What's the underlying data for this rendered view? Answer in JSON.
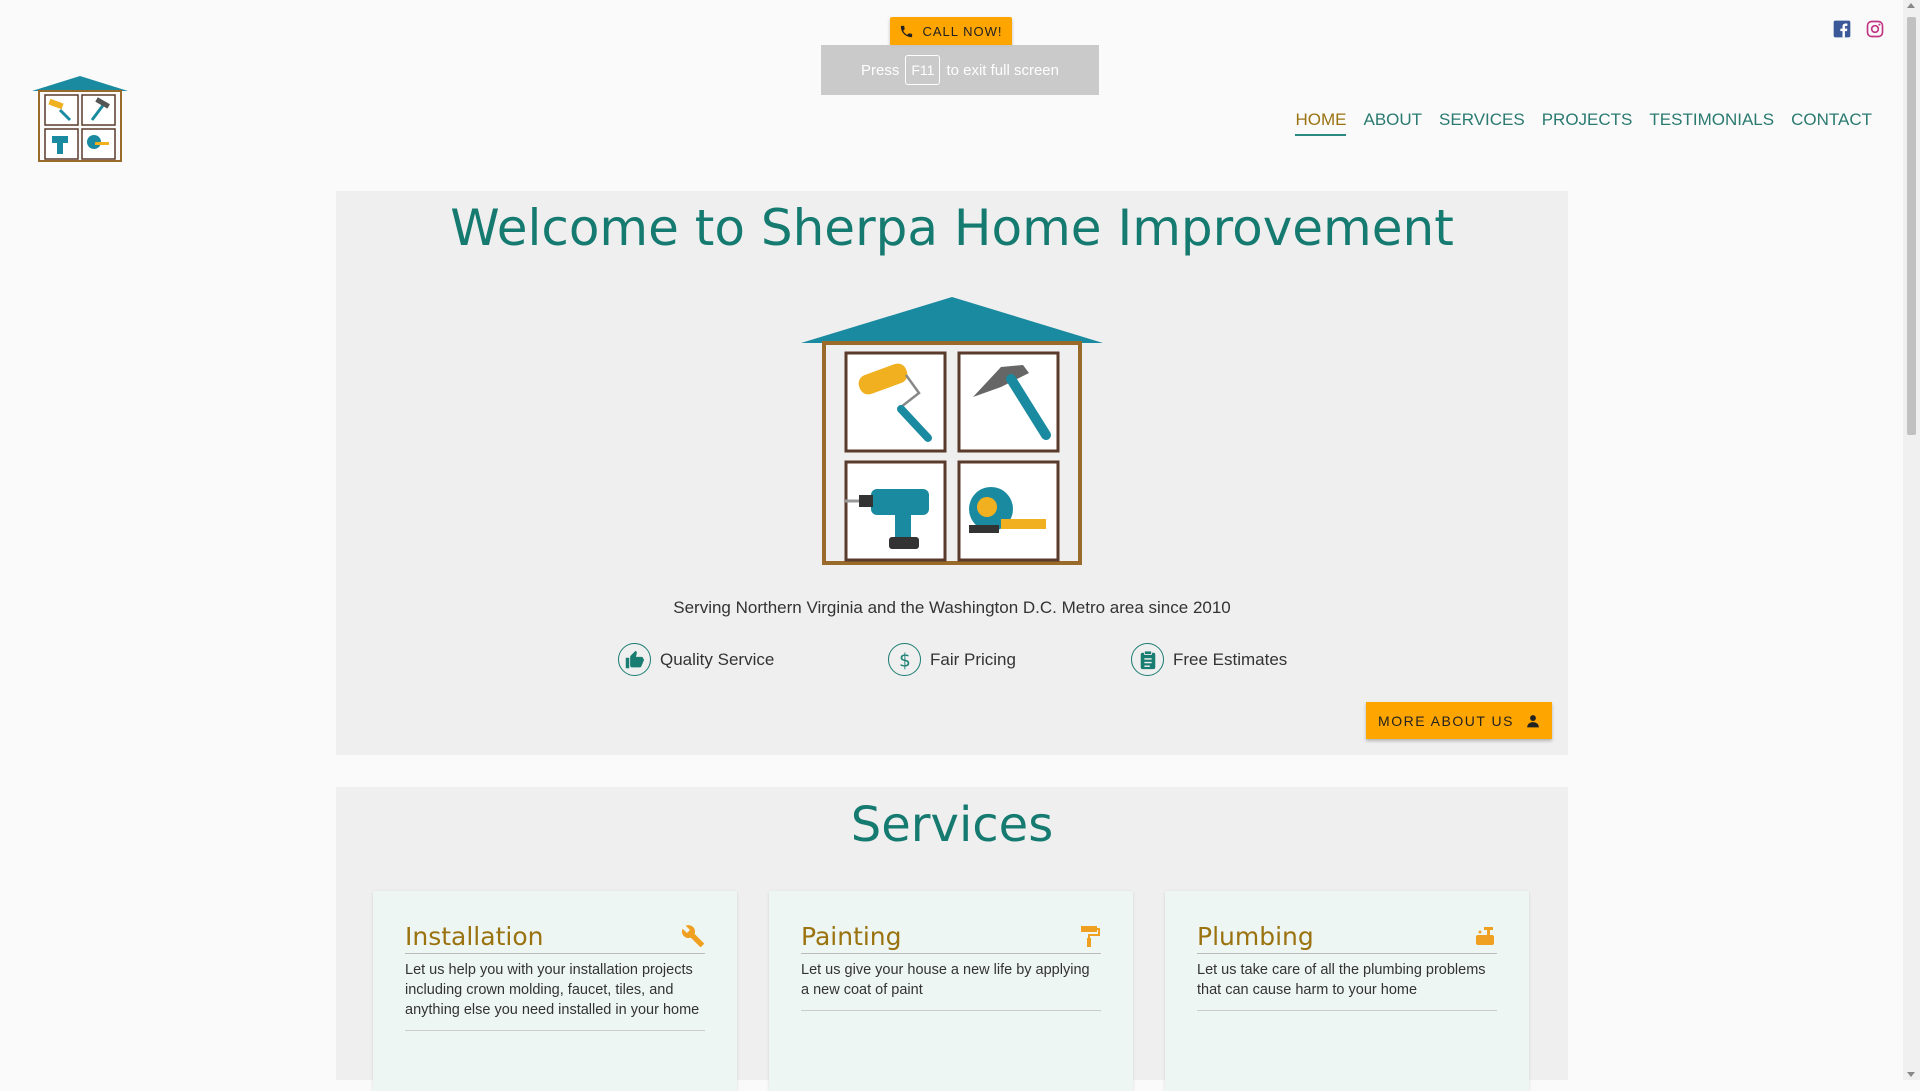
{
  "header": {
    "call_label": "CALL NOW!",
    "fullscreen_notice": {
      "before": "Press",
      "key": "F11",
      "after": "to exit full screen"
    }
  },
  "social": {
    "facebook_icon": "facebook-icon",
    "instagram_icon": "instagram-icon"
  },
  "nav": {
    "items": [
      "HOME",
      "ABOUT",
      "SERVICES",
      "PROJECTS",
      "TESTIMONIALS",
      "CONTACT"
    ],
    "active": "HOME"
  },
  "welcome": {
    "title": "Welcome to Sherpa Home Improvement",
    "tagline": "Serving Northern Virginia and the Washington D.C. Metro area since 2010",
    "features": [
      {
        "icon": "thumbs-up-icon",
        "label": "Quality Service"
      },
      {
        "icon": "dollar-icon",
        "label": "Fair Pricing"
      },
      {
        "icon": "clipboard-icon",
        "label": "Free Estimates"
      }
    ],
    "more_label": "MORE ABOUT US"
  },
  "services": {
    "title": "Services",
    "cards": [
      {
        "title": "Installation",
        "icon": "wrench-icon",
        "desc": "Let us help you with your installation projects including crown molding, faucet, tiles, and anything else you need installed in your home"
      },
      {
        "title": "Painting",
        "icon": "paint-roller-icon",
        "desc": "Let us give your house a new life by applying a new coat of paint"
      },
      {
        "title": "Plumbing",
        "icon": "faucet-icon",
        "desc": "Let us take care of all the plumbing problems that can cause harm to your home"
      }
    ]
  },
  "colors": {
    "accent": "#ffa500",
    "teal": "#157a70",
    "gold": "#9a7310"
  }
}
